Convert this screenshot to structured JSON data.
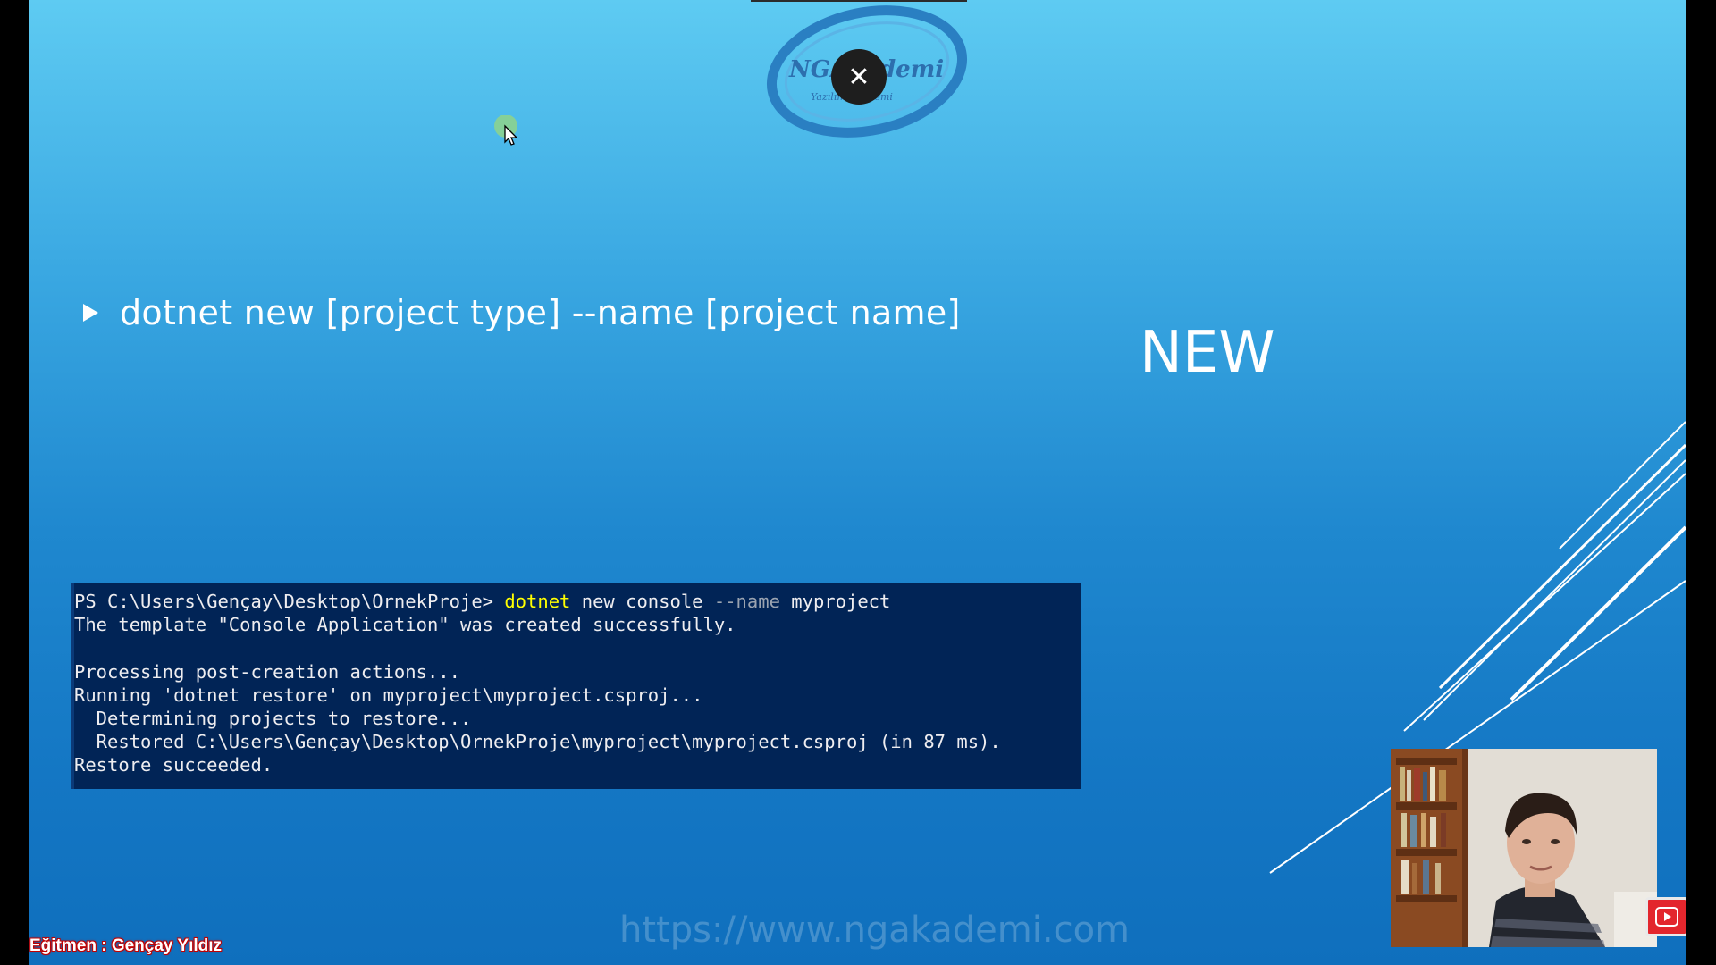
{
  "slide": {
    "bullet_text": "dotnet new [project type] --name [project name]",
    "title": "NEW",
    "watermark": "https://www.ngakademi.com",
    "instructor_caption": "Eğitmen : Gençay Yıldız"
  },
  "logo": {
    "text_main": "NGAkademi",
    "text_sub": "Yazılım Akademi"
  },
  "overlay": {
    "close_symbol": "✕"
  },
  "console": {
    "prompt": "PS C:\\Users\\Gençay\\Desktop\\OrnekProje> ",
    "command": "dotnet",
    "args_1": " new console ",
    "param": "--name",
    "args_2": " myproject",
    "lines": [
      "The template \"Console Application\" was created successfully.",
      "",
      "Processing post-creation actions...",
      "Running 'dotnet restore' on myproject\\myproject.csproj...",
      "  Determining projects to restore...",
      "  Restored C:\\Users\\Gençay\\Desktop\\OrnekProje\\myproject\\myproject.csproj (in 87 ms).",
      "Restore succeeded."
    ]
  },
  "icons": {
    "close": "close-icon",
    "cursor": "mouse-pointer-icon",
    "bullet": "triangle-bullet-icon",
    "youtube": "youtube-play-icon"
  },
  "colors": {
    "console_bg": "#012456",
    "console_cmd": "#ffff00",
    "instructor_outline": "#c00000",
    "youtube_red": "#e3262d"
  }
}
